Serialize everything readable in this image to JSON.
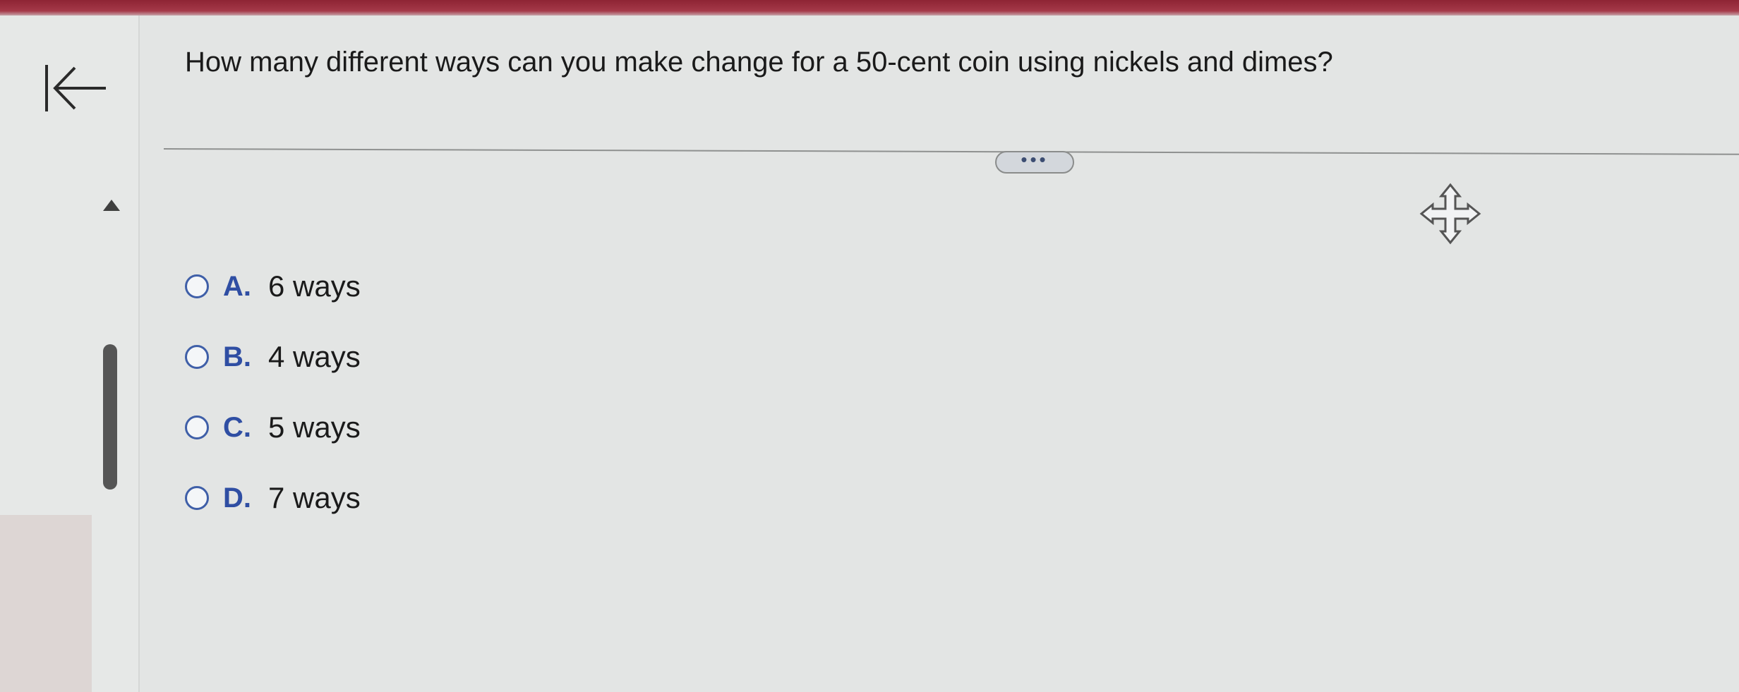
{
  "question": {
    "text": "How many different ways can you make change for a 50-cent coin using nickels and dimes?"
  },
  "toolbar": {
    "more_label": "•••"
  },
  "options": [
    {
      "letter": "A.",
      "text": "6 ways"
    },
    {
      "letter": "B.",
      "text": "4 ways"
    },
    {
      "letter": "C.",
      "text": "5 ways"
    },
    {
      "letter": "D.",
      "text": "7 ways"
    }
  ],
  "icons": {
    "collapse": "collapse-left-arrow-icon",
    "move": "move-arrows-icon",
    "scroll_up": "scroll-up-arrow-icon"
  },
  "colors": {
    "top_band": "#a43848",
    "option_letter": "#2f4ea3",
    "radio_border": "#3f5fa8"
  }
}
